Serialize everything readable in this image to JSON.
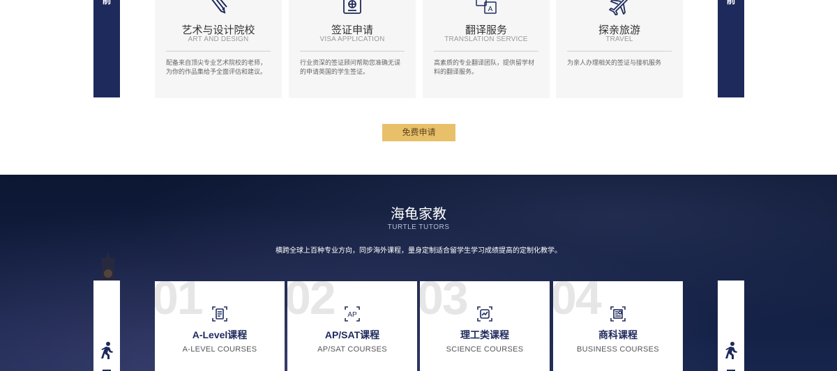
{
  "colors": {
    "navy": "#1e2a5c",
    "gold": "#e8c069",
    "card_bg": "#f6f6f6",
    "dark_bg": "#0c1733"
  },
  "side_tab_char": "前",
  "services": [
    {
      "icon": "pen-ruler-icon",
      "title_cn": "艺术与设计院校",
      "title_en": "ART AND DESIGN",
      "desc": "配备来自顶尖专业艺术院校的老师，为你的作品集给予全面评估和建议。"
    },
    {
      "icon": "passport-icon",
      "title_cn": "签证申请",
      "title_en": "VISA APPLICATION",
      "desc": "行业资深的签证顾问帮助您准确无误的申请英国的学生签证。"
    },
    {
      "icon": "translation-icon",
      "title_cn": "翻译服务",
      "title_en": "TRANSLATION SERVICE",
      "desc": "高素质的专业翻译团队，提供留学材料的翻译服务。"
    },
    {
      "icon": "airplane-icon",
      "title_cn": "探亲旅游",
      "title_en": "TRAVEL",
      "desc": "为亲人办理相关的签证与接机服务"
    }
  ],
  "free_apply_label": "免费申请",
  "tutors": {
    "title": "海龟家教",
    "subtitle": "TURTLE TUTORS",
    "description": "横跨全球上百种专业方向，同步海外课程，量身定制适合留学生学习成绩提高的定制化教学。",
    "courses": [
      {
        "num": "01",
        "icon": "clipboard-icon",
        "title_cn": "A-Level课程",
        "title_en": "A-LEVEL COURSES"
      },
      {
        "num": "02",
        "icon": "ap-badge-icon",
        "title_cn": "AP/SAT课程",
        "title_en": "AP/SAT COURSES"
      },
      {
        "num": "03",
        "icon": "science-scan-icon",
        "title_cn": "理工类课程",
        "title_en": "SCIENCE COURSES"
      },
      {
        "num": "04",
        "icon": "business-doc-icon",
        "title_cn": "商科课程",
        "title_en": "BUSINESS COURSES"
      }
    ]
  }
}
